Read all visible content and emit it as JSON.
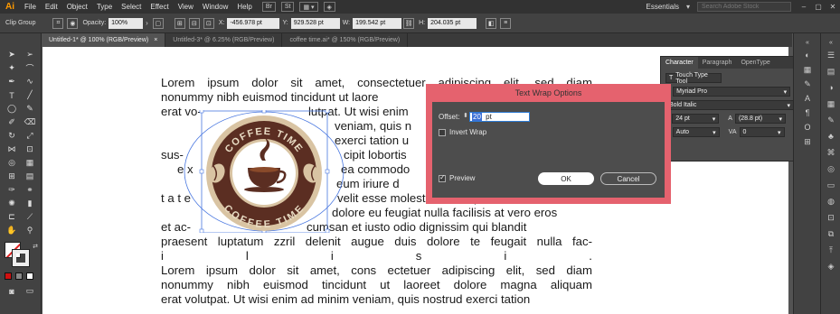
{
  "app": {
    "logo": "Ai"
  },
  "menu": [
    "File",
    "Edit",
    "Object",
    "Type",
    "Select",
    "Effect",
    "View",
    "Window",
    "Help"
  ],
  "menubar_right": {
    "workspace": "Essentials",
    "search_placeholder": "Search Adobe Stock"
  },
  "control": {
    "group_label": "Clip Group",
    "opacity_label": "Opacity:",
    "opacity_value": "100%",
    "x_label": "X:",
    "x_value": "-456.978 pt",
    "y_label": "Y:",
    "y_value": "929.528 pt",
    "w_label": "W:",
    "w_value": "199.542 pt",
    "h_label": "H:",
    "h_value": "204.035 pt"
  },
  "tabs": [
    "Untitled-1* @ 100% (RGB/Preview)",
    "Untitled-3* @ 6.25% (RGB/Preview)",
    "coffee time.ai* @ 150% (RGB/Preview)"
  ],
  "document": {
    "line1": "Lorem ipsum dolor sit amet, consectetuer adipiscing elit, sed diam",
    "line2": "nonummy nibh euismod tincidunt ut laore",
    "line3a": "erat vo-",
    "line3b": "lutpat. Ut wisi enim",
    "line4": "veniam, quis n",
    "line5": "exerci tation u",
    "line6a": "sus-",
    "line6b": "cipit lobortis",
    "line7a": "e x",
    "line7b": "ea commodo",
    "line8": "eum iriure d",
    "line9a": "t a t e",
    "line9b": "velit esse molestie consequat, vel illum",
    "line10": "dolore eu feugiat nulla facilisis at vero eros",
    "line11a": "et ac-",
    "line11b": "cumsan et iusto odio dignissim qui blandit",
    "line12": "praesent luptatum zzril delenit augue duis dolore te feugait nulla fac-",
    "line13": [
      "i",
      "l",
      "i",
      "s",
      "i",
      "."
    ],
    "line14": "Lorem ipsum dolor sit amet, cons ectetuer adipiscing elit, sed diam",
    "line15": "nonummy nibh euismod tincidunt ut laoreet dolore magna aliquam",
    "line16": "erat volutpat. Ut wisi enim ad minim veniam, quis nostrud exerci tation"
  },
  "logo": {
    "top_text": "COFFEE TIME",
    "bottom_text": "COFFEE TIME"
  },
  "character_panel": {
    "tabs": [
      "Character",
      "Paragraph",
      "OpenType"
    ],
    "touch_type": "Touch Type Tool",
    "font_family": "Myriad Pro",
    "font_style": "Bold Italic",
    "font_size": "24 pt",
    "leading": "(28.8 pt)",
    "kerning": "Auto",
    "tracking": "0"
  },
  "dialog": {
    "title": "Text Wrap Options",
    "offset_label": "Offset:",
    "offset_value": "20",
    "offset_unit": "pt",
    "invert_label": "Invert Wrap",
    "preview_label": "Preview",
    "ok_label": "OK",
    "cancel_label": "Cancel"
  },
  "colors": {
    "dialog_title": "#e5626e",
    "logo_brown": "#5b2e22",
    "logo_tan": "#d9c4a3",
    "app_orange": "#ff9a00"
  }
}
